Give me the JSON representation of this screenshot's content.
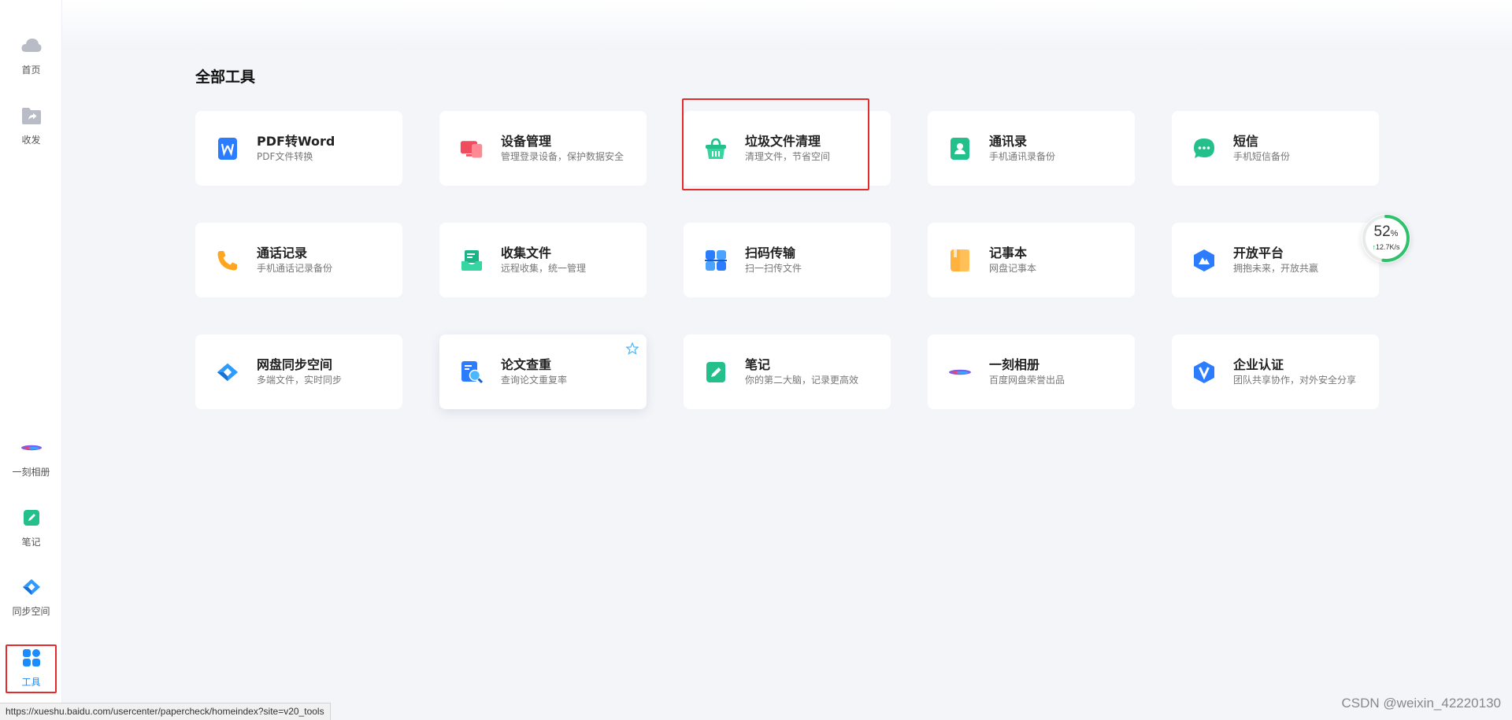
{
  "sidebar": {
    "items": [
      {
        "label": "首页",
        "icon": "cloud-icon"
      },
      {
        "label": "收发",
        "icon": "share-folder-icon"
      },
      {
        "label": "一刻相册",
        "icon": "album-icon"
      },
      {
        "label": "笔记",
        "icon": "note-icon"
      },
      {
        "label": "同步空间",
        "icon": "sync-icon"
      },
      {
        "label": "工具",
        "icon": "tools-grid-icon",
        "active": true
      }
    ]
  },
  "main": {
    "title": "全部工具",
    "tools": [
      {
        "title": "PDF转Word",
        "subtitle": "PDF文件转换",
        "icon": "pdf-word-icon"
      },
      {
        "title": "设备管理",
        "subtitle": "管理登录设备，保护数据安全",
        "icon": "device-icon"
      },
      {
        "title": "垃圾文件清理",
        "subtitle": "清理文件，节省空间",
        "icon": "trash-basket-icon"
      },
      {
        "title": "通讯录",
        "subtitle": "手机通讯录备份",
        "icon": "contacts-icon"
      },
      {
        "title": "短信",
        "subtitle": "手机短信备份",
        "icon": "sms-icon"
      },
      {
        "title": "通话记录",
        "subtitle": "手机通话记录备份",
        "icon": "phone-icon"
      },
      {
        "title": "收集文件",
        "subtitle": "远程收集，统一管理",
        "icon": "collect-icon"
      },
      {
        "title": "扫码传输",
        "subtitle": "扫一扫传文件",
        "icon": "scan-icon"
      },
      {
        "title": "记事本",
        "subtitle": "网盘记事本",
        "icon": "notepad-icon"
      },
      {
        "title": "开放平台",
        "subtitle": "拥抱未来，开放共赢",
        "icon": "open-platform-icon"
      },
      {
        "title": "网盘同步空间",
        "subtitle": "多端文件，实时同步",
        "icon": "sync-space-icon"
      },
      {
        "title": "论文查重",
        "subtitle": "查询论文重复率",
        "icon": "paper-check-icon"
      },
      {
        "title": "笔记",
        "subtitle": "你的第二大脑，记录更高效",
        "icon": "note-pen-icon"
      },
      {
        "title": "一刻相册",
        "subtitle": "百度网盘荣誉出品",
        "icon": "album-icon"
      },
      {
        "title": "企业认证",
        "subtitle": "团队共享协作，对外安全分享",
        "icon": "enterprise-v-icon"
      }
    ]
  },
  "speed_widget": {
    "percent": "52",
    "percent_unit": "%",
    "arrow": "↑",
    "rate": "12.7K/s",
    "progress": 0.52
  },
  "status_url": "https://xueshu.baidu.com/usercenter/papercheck/homeindex?site=v20_tools",
  "watermark": "CSDN @weixin_42220130",
  "colors": {
    "accent": "#1a8cff",
    "highlight_box": "#e32b2b",
    "progress_green": "#2ec26a"
  }
}
